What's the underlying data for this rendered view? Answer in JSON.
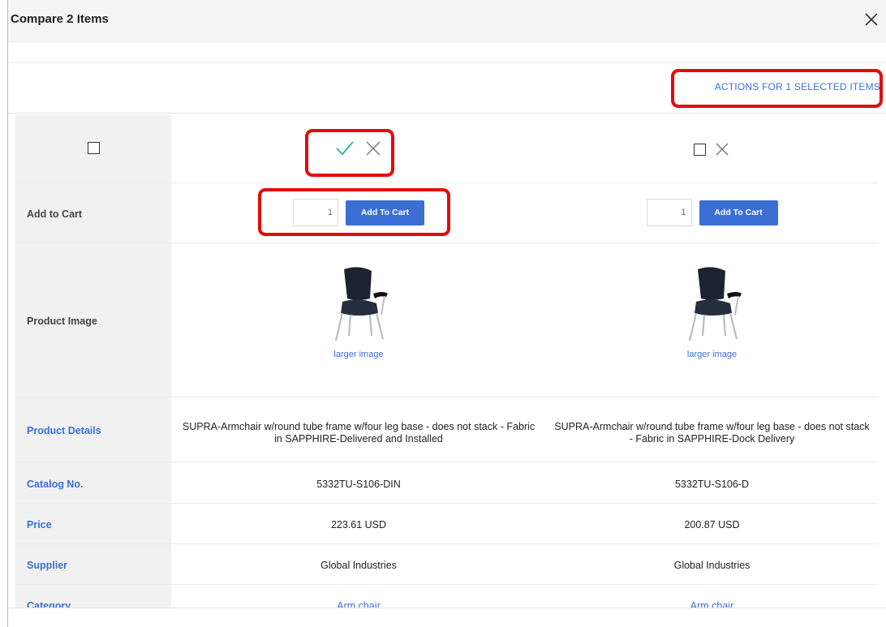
{
  "dialog": {
    "title": "Compare 2 Items",
    "actions_label": "ACTIONS FOR 1 SELECTED ITEMS"
  },
  "rows": {
    "add_to_cart": "Add to Cart",
    "product_image": "Product Image",
    "product_details": "Product Details",
    "catalog_no": "Catalog No.",
    "price": "Price",
    "supplier": "Supplier",
    "category": "Category"
  },
  "items": [
    {
      "selected": true,
      "quantity": "1",
      "add_to_cart_label": "Add To Cart",
      "larger_image_label": "larger image",
      "details": "SUPRA-Armchair w/round tube frame w/four leg base - does not stack - Fabric in SAPPHIRE-Delivered and Installed",
      "catalog_no": "5332TU-S106-DIN",
      "price": "223.61 USD",
      "supplier": "Global Industries",
      "category": "Arm chair"
    },
    {
      "selected": false,
      "quantity": "1",
      "add_to_cart_label": "Add To Cart",
      "larger_image_label": "larger image",
      "details": "SUPRA-Armchair w/round tube frame w/four leg base - does not stack - Fabric in SAPPHIRE-Dock Delivery",
      "catalog_no": "5332TU-S106-D",
      "price": "200.87 USD",
      "supplier": "Global Industries",
      "category": "Arm chair"
    }
  ],
  "colors": {
    "accent": "#3b6fd6",
    "check": "#2bb39a",
    "highlight": "#e40b0b",
    "label_column": "#f1f1f1"
  },
  "icons": {
    "close": "close-icon",
    "check": "checkmark-icon",
    "remove": "remove-x-icon",
    "checkbox": "checkbox-icon",
    "product": "armchair-image"
  }
}
